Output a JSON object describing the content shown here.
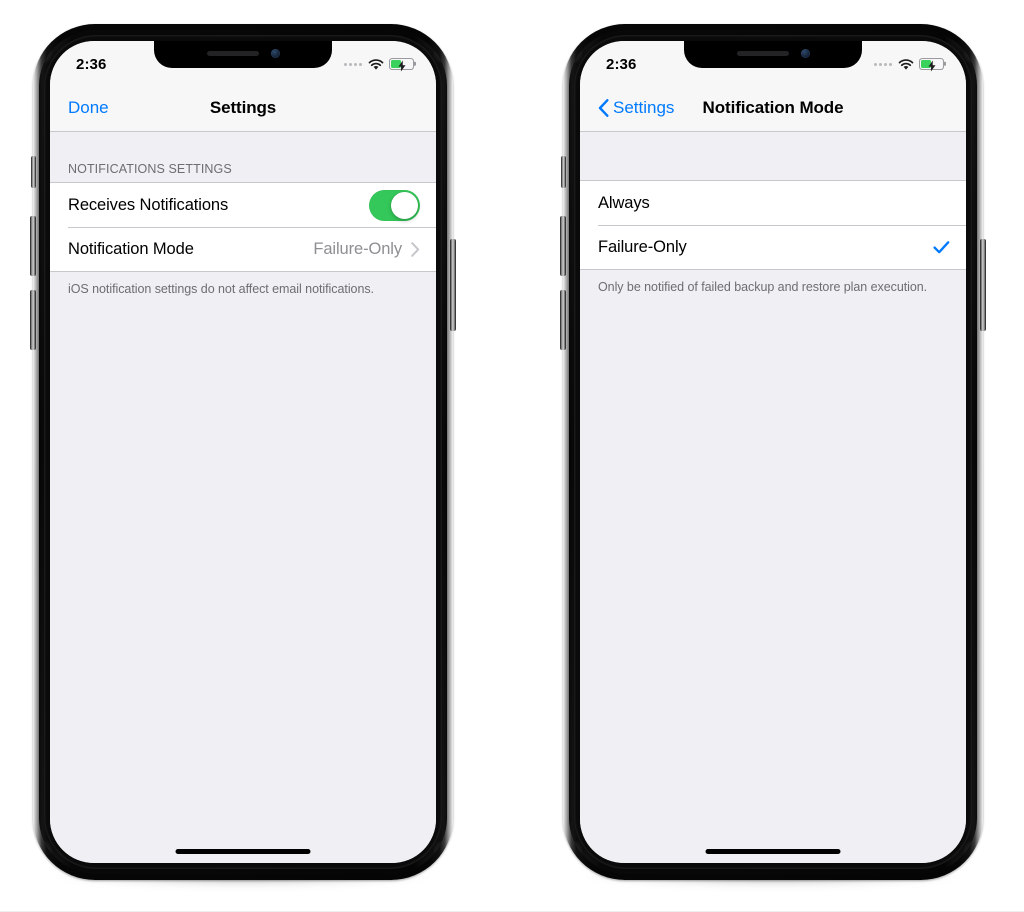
{
  "background_color": "#ffffff",
  "accent_color": "#007aff",
  "toggle_on_color": "#34c759",
  "phones": [
    {
      "id": "settings-screen",
      "status_bar": {
        "time": "2:36",
        "signal_icon": "signal-dots-icon",
        "wifi_icon": "wifi-icon",
        "battery_icon": "battery-charging-icon",
        "battery_level_percent": 48
      },
      "nav_bar": {
        "left_button_label": "Done",
        "left_button_has_chevron": false,
        "title": "Settings"
      },
      "section": {
        "header": "NOTIFICATIONS SETTINGS",
        "rows": [
          {
            "label": "Receives Notifications",
            "control": "toggle",
            "toggle_on": true
          },
          {
            "label": "Notification Mode",
            "control": "disclosure",
            "value": "Failure-Only"
          }
        ],
        "footnote": "iOS notification settings do not affect email notifications."
      },
      "home_indicator": true
    },
    {
      "id": "notification-mode-screen",
      "status_bar": {
        "time": "2:36",
        "signal_icon": "signal-dots-icon",
        "wifi_icon": "wifi-icon",
        "battery_icon": "battery-charging-icon",
        "battery_level_percent": 48
      },
      "nav_bar": {
        "left_button_label": "Settings",
        "left_button_has_chevron": true,
        "title": "Notification Mode"
      },
      "section": {
        "header": "",
        "rows": [
          {
            "label": "Always",
            "control": "none",
            "selected": false
          },
          {
            "label": "Failure-Only",
            "control": "checkmark",
            "selected": true
          }
        ],
        "footnote": "Only be notified of failed backup and restore plan execution."
      },
      "home_indicator": true
    }
  ]
}
